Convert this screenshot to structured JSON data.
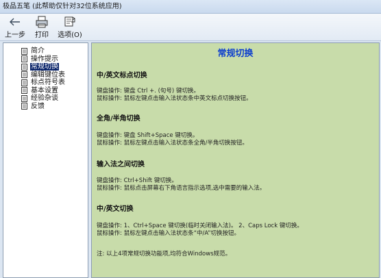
{
  "window": {
    "title": "极品五笔 (此帮助仅针对32位系统应用)"
  },
  "toolbar": {
    "back_label": "上一步",
    "print_label": "打印",
    "options_label": "选项(O)"
  },
  "sidebar": {
    "items": [
      {
        "label": "简介"
      },
      {
        "label": "操作提示"
      },
      {
        "label": "常规切换"
      },
      {
        "label": "编辑键位表"
      },
      {
        "label": "标点符号表"
      },
      {
        "label": "基本设置"
      },
      {
        "label": "经验杂谈"
      },
      {
        "label": "反馈"
      }
    ],
    "selected_index": 2
  },
  "content": {
    "title": "常规切换",
    "sections": [
      {
        "heading": "中/英文标点切换",
        "lines": [
          "键盘操作: 键盘 Ctrl +. (句号) 键切换。",
          "鼠标操作: 鼠标左键点击输入法状态条中英文标点切换按钮。"
        ]
      },
      {
        "heading": "全角/半角切换",
        "lines": [
          "键盘操作: 键盘 Shift+Space 键切换。",
          "鼠标操作: 鼠标左键点击输入法状态条全角/半角切换按钮。"
        ]
      },
      {
        "heading": "输入法之间切换",
        "lines": [
          "键盘操作: Ctrl+Shift 键切换。",
          "鼠标操作: 鼠标点击屏幕右下角语言指示选项,选中需要的输入法。"
        ]
      },
      {
        "heading": "中/英文切换",
        "lines": [
          "键盘操作: 1、Ctrl+Space 键切换(临时关闭输入法)。 2、Caps Lock 键切换。",
          "鼠标操作: 鼠标左键点击输入法状态条“中/A”切换按钮。"
        ]
      }
    ],
    "note": "注: 以上4项常规切换功能项,均符合Windows规范。"
  },
  "colors": {
    "content_bg": "#c8dcaa",
    "title_color": "#0a3ccf",
    "selection_bg": "#0a246a"
  }
}
